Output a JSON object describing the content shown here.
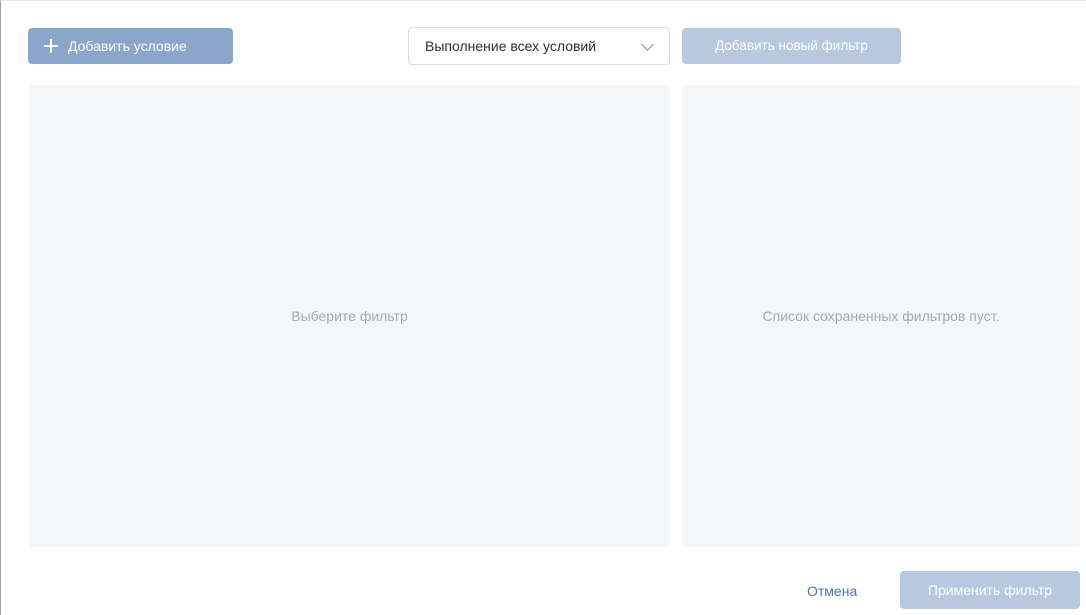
{
  "toolbar": {
    "add_condition_label": "Добавить условие",
    "condition_mode": {
      "selected": "Выполнение всех условий"
    },
    "add_new_filter_label": "Добавить новый фильтр"
  },
  "editor_panel": {
    "placeholder": "Выберите фильтр"
  },
  "saved_filters_panel": {
    "empty_message": "Список сохраненных фильтров пуст."
  },
  "footer": {
    "cancel_label": "Отмена",
    "apply_label": "Применить фильтр"
  },
  "colors": {
    "primary_button": "#8aa7c9",
    "disabled_button": "#b7c9de",
    "panel_background": "#f5f6f8",
    "link": "#4a76a8"
  }
}
